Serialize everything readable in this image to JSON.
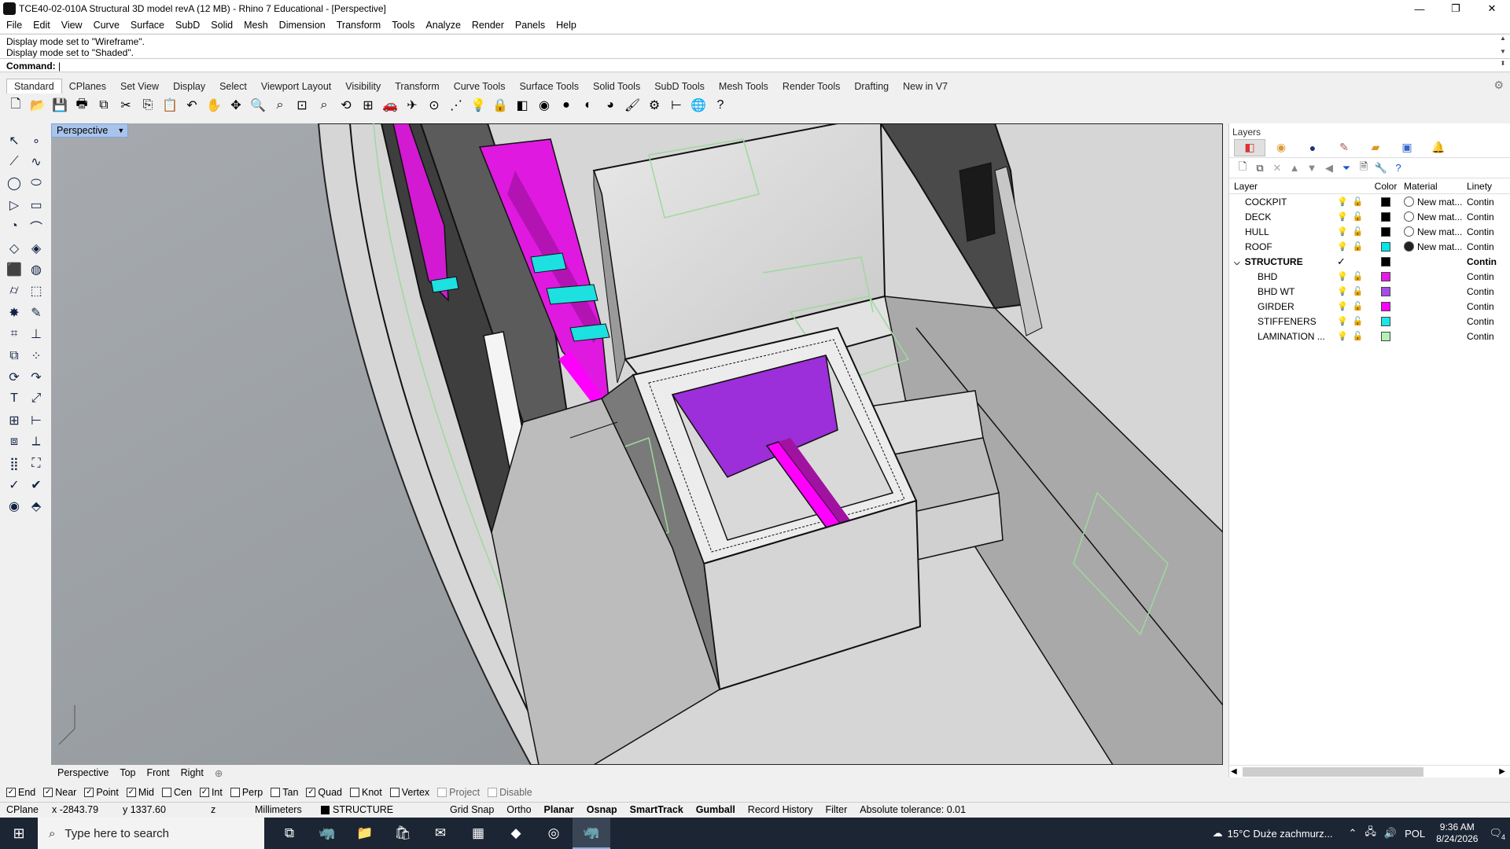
{
  "window": {
    "title": "TCE40-02-010A Structural 3D model revA (12 MB) - Rhino 7 Educational - [Perspective]",
    "minimize": "—",
    "maximize": "❐",
    "close": "✕"
  },
  "menu": [
    "File",
    "Edit",
    "View",
    "Curve",
    "Surface",
    "SubD",
    "Solid",
    "Mesh",
    "Dimension",
    "Transform",
    "Tools",
    "Analyze",
    "Render",
    "Panels",
    "Help"
  ],
  "command": {
    "history": [
      "Display mode set to \"Wireframe\".",
      "Display mode set to \"Shaded\"."
    ],
    "prompt": "Command:"
  },
  "toolbar_tabs": [
    "Standard",
    "CPlanes",
    "Set View",
    "Display",
    "Select",
    "Viewport Layout",
    "Visibility",
    "Transform",
    "Curve Tools",
    "Surface Tools",
    "Solid Tools",
    "SubD Tools",
    "Mesh Tools",
    "Render Tools",
    "Drafting",
    "New in V7"
  ],
  "toolbar_icons": [
    {
      "name": "new-icon",
      "glyph": "🗋"
    },
    {
      "name": "open-icon",
      "glyph": "📂"
    },
    {
      "name": "save-icon",
      "glyph": "💾"
    },
    {
      "name": "print-icon",
      "glyph": "🖶"
    },
    {
      "name": "export-icon",
      "glyph": "⧉"
    },
    {
      "name": "cut-icon",
      "glyph": "✂"
    },
    {
      "name": "copy-icon",
      "glyph": "⎘"
    },
    {
      "name": "paste-icon",
      "glyph": "📋"
    },
    {
      "name": "undo-icon",
      "glyph": "↶"
    },
    {
      "name": "pan-icon",
      "glyph": "✋"
    },
    {
      "name": "move-view-icon",
      "glyph": "✥"
    },
    {
      "name": "zoom-icon",
      "glyph": "🔍"
    },
    {
      "name": "zoom-window-icon",
      "glyph": "⌕"
    },
    {
      "name": "zoom-extents-icon",
      "glyph": "⊡"
    },
    {
      "name": "zoom-selected-icon",
      "glyph": "⌕"
    },
    {
      "name": "rotate-view-icon",
      "glyph": "⟲"
    },
    {
      "name": "four-views-icon",
      "glyph": "⊞"
    },
    {
      "name": "car-icon",
      "glyph": "🚗"
    },
    {
      "name": "plane-icon",
      "glyph": "✈"
    },
    {
      "name": "cplane-icon",
      "glyph": "⊙"
    },
    {
      "name": "grid-snap-icon",
      "glyph": "⋰"
    },
    {
      "name": "light-icon",
      "glyph": "💡"
    },
    {
      "name": "lock-icon",
      "glyph": "🔒"
    },
    {
      "name": "layer-icon",
      "glyph": "◧"
    },
    {
      "name": "color-wheel-icon",
      "glyph": "◉"
    },
    {
      "name": "shade-icon",
      "glyph": "●"
    },
    {
      "name": "render-preview-icon",
      "glyph": "◐"
    },
    {
      "name": "render-icon",
      "glyph": "◕"
    },
    {
      "name": "material-icon",
      "glyph": "🖌"
    },
    {
      "name": "options-icon",
      "glyph": "⚙"
    },
    {
      "name": "dimension-icon",
      "glyph": "⊢"
    },
    {
      "name": "globe-icon",
      "glyph": "🌐"
    },
    {
      "name": "help-icon",
      "glyph": "?"
    }
  ],
  "left_tools": [
    {
      "name": "select-icon",
      "glyph": "↖"
    },
    {
      "name": "point-icon",
      "glyph": "∘"
    },
    {
      "name": "polyline-icon",
      "glyph": "⟋"
    },
    {
      "name": "curve-icon",
      "glyph": "∿"
    },
    {
      "name": "circle-icon",
      "glyph": "◯"
    },
    {
      "name": "ellipse-icon",
      "glyph": "⬭"
    },
    {
      "name": "polygon-icon",
      "glyph": "▷"
    },
    {
      "name": "rectangle-icon",
      "glyph": "▭"
    },
    {
      "name": "arc-icon",
      "glyph": "◔"
    },
    {
      "name": "fillet-curve-icon",
      "glyph": "⌒"
    },
    {
      "name": "surface-icon",
      "glyph": "◇"
    },
    {
      "name": "loft-icon",
      "glyph": "◈"
    },
    {
      "name": "box-icon",
      "glyph": "⬛"
    },
    {
      "name": "boolean-icon",
      "glyph": "◍"
    },
    {
      "name": "cylinder-icon",
      "glyph": "⌭"
    },
    {
      "name": "extrude-icon",
      "glyph": "⬚"
    },
    {
      "name": "explode-icon",
      "glyph": "✸"
    },
    {
      "name": "edit-icon",
      "glyph": "✎"
    },
    {
      "name": "mesh-icon",
      "glyph": "⌗"
    },
    {
      "name": "transform-icon",
      "glyph": "⊥"
    },
    {
      "name": "boolean-union-icon",
      "glyph": "⧉"
    },
    {
      "name": "array-icon",
      "glyph": "⁘"
    },
    {
      "name": "rotate-icon",
      "glyph": "⟳"
    },
    {
      "name": "bend-icon",
      "glyph": "↷"
    },
    {
      "name": "text-icon",
      "glyph": "T"
    },
    {
      "name": "scale-icon",
      "glyph": "⤢"
    },
    {
      "name": "group-icon",
      "glyph": "⊞"
    },
    {
      "name": "dimension-icon",
      "glyph": "⊢"
    },
    {
      "name": "block-icon",
      "glyph": "⧈"
    },
    {
      "name": "measure-icon",
      "glyph": "⟂"
    },
    {
      "name": "grid-array-icon",
      "glyph": "⣿"
    },
    {
      "name": "history-icon",
      "glyph": "⛶"
    },
    {
      "name": "analyze-icon",
      "glyph": "✓"
    },
    {
      "name": "check-icon",
      "glyph": "✔"
    },
    {
      "name": "render-tool-icon",
      "glyph": "◉"
    },
    {
      "name": "paint-icon",
      "glyph": "⬘"
    }
  ],
  "viewport": {
    "name": "Perspective",
    "tabs": [
      "Perspective",
      "Top",
      "Front",
      "Right"
    ]
  },
  "layers_panel": {
    "title": "Layers",
    "columns": {
      "layer": "Layer",
      "color": "Color",
      "material": "Material",
      "linetype": "Linety"
    },
    "rows": [
      {
        "name": "COCKPIT",
        "color": "#000000",
        "material": "New mat...",
        "mat_fill": "#ffffff",
        "linetype": "Contin",
        "bold": false,
        "child": false
      },
      {
        "name": "DECK",
        "color": "#000000",
        "material": "New mat...",
        "mat_fill": "#ffffff",
        "linetype": "Contin",
        "bold": false,
        "child": false
      },
      {
        "name": "HULL",
        "color": "#000000",
        "material": "New mat...",
        "mat_fill": "#ffffff",
        "linetype": "Contin",
        "bold": false,
        "child": false
      },
      {
        "name": "ROOF",
        "color": "#00e5e5",
        "material": "New mat...",
        "mat_fill": "#222222",
        "linetype": "Contin",
        "bold": false,
        "child": false
      },
      {
        "name": "STRUCTURE",
        "color": "#000000",
        "material": "",
        "mat_fill": "",
        "linetype": "Contin",
        "bold": true,
        "child": false
      },
      {
        "name": "BHD",
        "color": "#e619e6",
        "material": "",
        "mat_fill": "",
        "linetype": "Contin",
        "bold": false,
        "child": true
      },
      {
        "name": "BHD WT",
        "color": "#a64ce6",
        "material": "",
        "mat_fill": "",
        "linetype": "Contin",
        "bold": false,
        "child": true
      },
      {
        "name": "GIRDER",
        "color": "#ff00ff",
        "material": "",
        "mat_fill": "",
        "linetype": "Contin",
        "bold": false,
        "child": true
      },
      {
        "name": "STIFFENERS",
        "color": "#1ae6e6",
        "material": "",
        "mat_fill": "",
        "linetype": "Contin",
        "bold": false,
        "child": true
      },
      {
        "name": "LAMINATION ...",
        "color": "#b3f0b3",
        "material": "",
        "mat_fill": "",
        "linetype": "Contin",
        "bold": false,
        "child": true
      }
    ]
  },
  "osnaps": [
    {
      "label": "End",
      "checked": true,
      "enabled": true
    },
    {
      "label": "Near",
      "checked": true,
      "enabled": true
    },
    {
      "label": "Point",
      "checked": true,
      "enabled": true
    },
    {
      "label": "Mid",
      "checked": true,
      "enabled": true
    },
    {
      "label": "Cen",
      "checked": false,
      "enabled": true
    },
    {
      "label": "Int",
      "checked": true,
      "enabled": true
    },
    {
      "label": "Perp",
      "checked": false,
      "enabled": true
    },
    {
      "label": "Tan",
      "checked": false,
      "enabled": true
    },
    {
      "label": "Quad",
      "checked": true,
      "enabled": true
    },
    {
      "label": "Knot",
      "checked": false,
      "enabled": true
    },
    {
      "label": "Vertex",
      "checked": false,
      "enabled": true
    },
    {
      "label": "Project",
      "checked": false,
      "enabled": false
    },
    {
      "label": "Disable",
      "checked": false,
      "enabled": false
    }
  ],
  "status": {
    "cplane": "CPlane",
    "x": "x -2843.79",
    "y": "y 1337.60",
    "z": "z",
    "units": "Millimeters",
    "layer": "STRUCTURE",
    "layer_color": "#000000",
    "toggles": [
      {
        "label": "Grid Snap",
        "bold": false
      },
      {
        "label": "Ortho",
        "bold": false
      },
      {
        "label": "Planar",
        "bold": true
      },
      {
        "label": "Osnap",
        "bold": true
      },
      {
        "label": "SmartTrack",
        "bold": true
      },
      {
        "label": "Gumball",
        "bold": true
      },
      {
        "label": "Record History",
        "bold": false
      },
      {
        "label": "Filter",
        "bold": false
      }
    ],
    "tolerance": "Absolute tolerance: 0.01"
  },
  "taskbar": {
    "search_placeholder": "Type here to search",
    "weather": "15°C  Duże zachmurz...",
    "language": "POL",
    "time": "9:36 AM",
    "date": "8/24/2026",
    "notifications": "4",
    "apps": [
      {
        "name": "task-view-icon",
        "glyph": "⧉",
        "active": false
      },
      {
        "name": "rhino-app-icon",
        "glyph": "🦏",
        "active": false
      },
      {
        "name": "file-explorer-icon",
        "glyph": "📁",
        "active": false
      },
      {
        "name": "store-icon",
        "glyph": "🛍",
        "active": false
      },
      {
        "name": "outlook-icon",
        "glyph": "✉",
        "active": false
      },
      {
        "name": "calculator-icon",
        "glyph": "▦",
        "active": false
      },
      {
        "name": "figma-icon",
        "glyph": "◆",
        "active": false
      },
      {
        "name": "chrome-icon",
        "glyph": "◎",
        "active": false
      },
      {
        "name": "rhino7-icon",
        "glyph": "🦏",
        "active": true
      }
    ]
  }
}
